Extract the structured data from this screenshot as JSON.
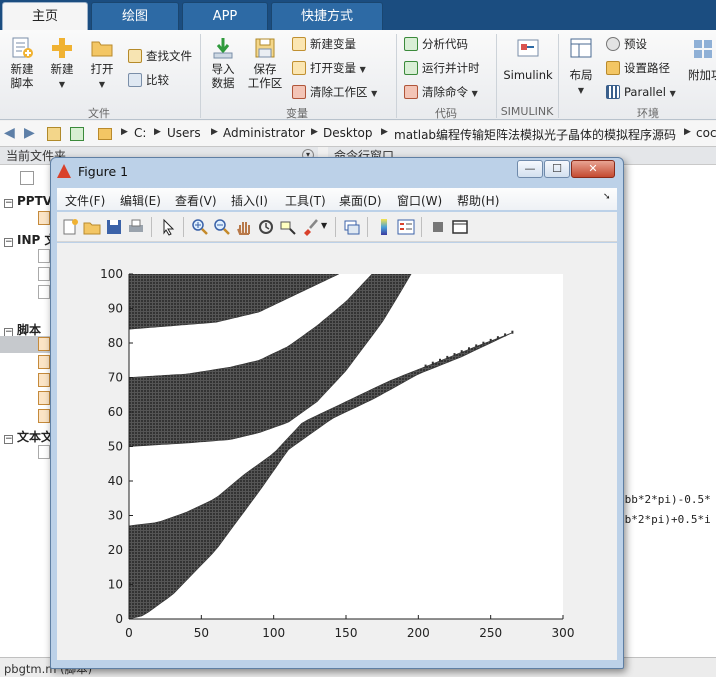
{
  "tabs": [
    {
      "label": "主页",
      "active": true
    },
    {
      "label": "绘图",
      "active": false
    },
    {
      "label": "APP",
      "active": false
    },
    {
      "label": "快捷方式",
      "active": false
    }
  ],
  "ribbon": {
    "file": {
      "new_script": "新建\n脚本",
      "new": "新建",
      "open": "打开",
      "find_files": "查找文件",
      "compare": "比较",
      "section": "文件"
    },
    "variable": {
      "import_data": "导入\n数据",
      "save_workspace": "保存\n工作区",
      "new_variable": "新建变量",
      "open_variable": "打开变量",
      "clear_workspace": "清除工作区",
      "section": "变量"
    },
    "code": {
      "analyze_code": "分析代码",
      "run_and_time": "运行并计时",
      "clear_commands": "清除命令",
      "section": "代码"
    },
    "simulink": {
      "button": "Simulink",
      "section": "SIMULINK"
    },
    "environment": {
      "layout": "布局",
      "preferences": "预设",
      "set_path": "设置路径",
      "parallel": "Parallel",
      "addons": "附加功",
      "section": "环境"
    }
  },
  "address": {
    "crumbs": [
      "C:",
      "Users",
      "Administrator",
      "Desktop",
      "matlab编程传输矩阵法模拟光子晶体的模拟程序源码",
      "coc"
    ]
  },
  "left_panel": {
    "header": "当前文件夹",
    "groups": [
      "PPTV",
      "INP 文",
      "脚本",
      "文本文"
    ]
  },
  "right_panel": {
    "header": "命令行窗口",
    "lines": [
      "*bb*2*pi)-0.5*",
      "bb*2*pi)+0.5*i"
    ]
  },
  "status": {
    "file": "pbgtm.m  (脚本)"
  },
  "figure": {
    "title": "Figure 1",
    "menu": [
      "文件(F)",
      "编辑(E)",
      "查看(V)",
      "插入(I)",
      "工具(T)",
      "桌面(D)",
      "窗口(W)",
      "帮助(H)"
    ],
    "toolbar_icons": [
      "new-figure-icon",
      "open-file-icon",
      "save-icon",
      "print-icon",
      "pointer-icon",
      "zoom-in-icon",
      "zoom-out-icon",
      "pan-icon",
      "rotate-icon",
      "data-cursor-icon",
      "brush-icon",
      "link-plot-icon",
      "colorbar-icon",
      "legend-icon",
      "hide-plot-tools-icon",
      "show-plot-tools-icon"
    ],
    "window_buttons": [
      "—",
      "☐",
      "✕"
    ]
  },
  "chart_data": {
    "type": "scatter",
    "title": "",
    "xlabel": "",
    "ylabel": "",
    "xlim": [
      0,
      300
    ],
    "ylim": [
      0,
      100
    ],
    "xticks": [
      0,
      50,
      100,
      150,
      200,
      250,
      300
    ],
    "yticks": [
      0,
      10,
      20,
      30,
      40,
      50,
      60,
      70,
      80,
      90,
      100
    ],
    "grid": false,
    "marker": "dense small dots",
    "colors": {
      "marker": "#333333",
      "axes_bg": "#ffffff"
    },
    "bands": [
      {
        "name": "",
        "lower": [
          [
            0,
            84
          ],
          [
            30,
            85
          ],
          [
            60,
            86
          ],
          [
            90,
            89
          ],
          [
            110,
            93
          ],
          [
            130,
            97
          ],
          [
            145,
            100
          ]
        ],
        "upper": [
          [
            0,
            100
          ],
          [
            120,
            100
          ]
        ]
      },
      {
        "name": "",
        "lower": [
          [
            0,
            50
          ],
          [
            40,
            51
          ],
          [
            70,
            52
          ],
          [
            90,
            54
          ],
          [
            110,
            57
          ],
          [
            130,
            63
          ],
          [
            150,
            72
          ],
          [
            175,
            86
          ],
          [
            188,
            95
          ],
          [
            195,
            100
          ]
        ],
        "upper": [
          [
            0,
            70
          ],
          [
            40,
            71
          ],
          [
            70,
            73
          ],
          [
            90,
            75
          ],
          [
            110,
            79
          ],
          [
            130,
            85
          ],
          [
            150,
            92
          ],
          [
            168,
            100
          ]
        ]
      },
      {
        "name": "",
        "lower": [
          [
            0,
            0
          ],
          [
            10,
            1
          ],
          [
            30,
            7
          ],
          [
            60,
            20
          ],
          [
            90,
            37
          ],
          [
            110,
            49
          ],
          [
            140,
            58
          ],
          [
            170,
            64
          ],
          [
            200,
            71
          ],
          [
            230,
            76
          ],
          [
            265,
            83
          ]
        ],
        "upper": [
          [
            0,
            27
          ],
          [
            20,
            28
          ],
          [
            40,
            31
          ],
          [
            60,
            35
          ],
          [
            80,
            42
          ],
          [
            100,
            48
          ],
          [
            120,
            57
          ],
          [
            150,
            63
          ],
          [
            180,
            69
          ],
          [
            210,
            74
          ],
          [
            240,
            79
          ],
          [
            265,
            83
          ]
        ]
      }
    ]
  }
}
